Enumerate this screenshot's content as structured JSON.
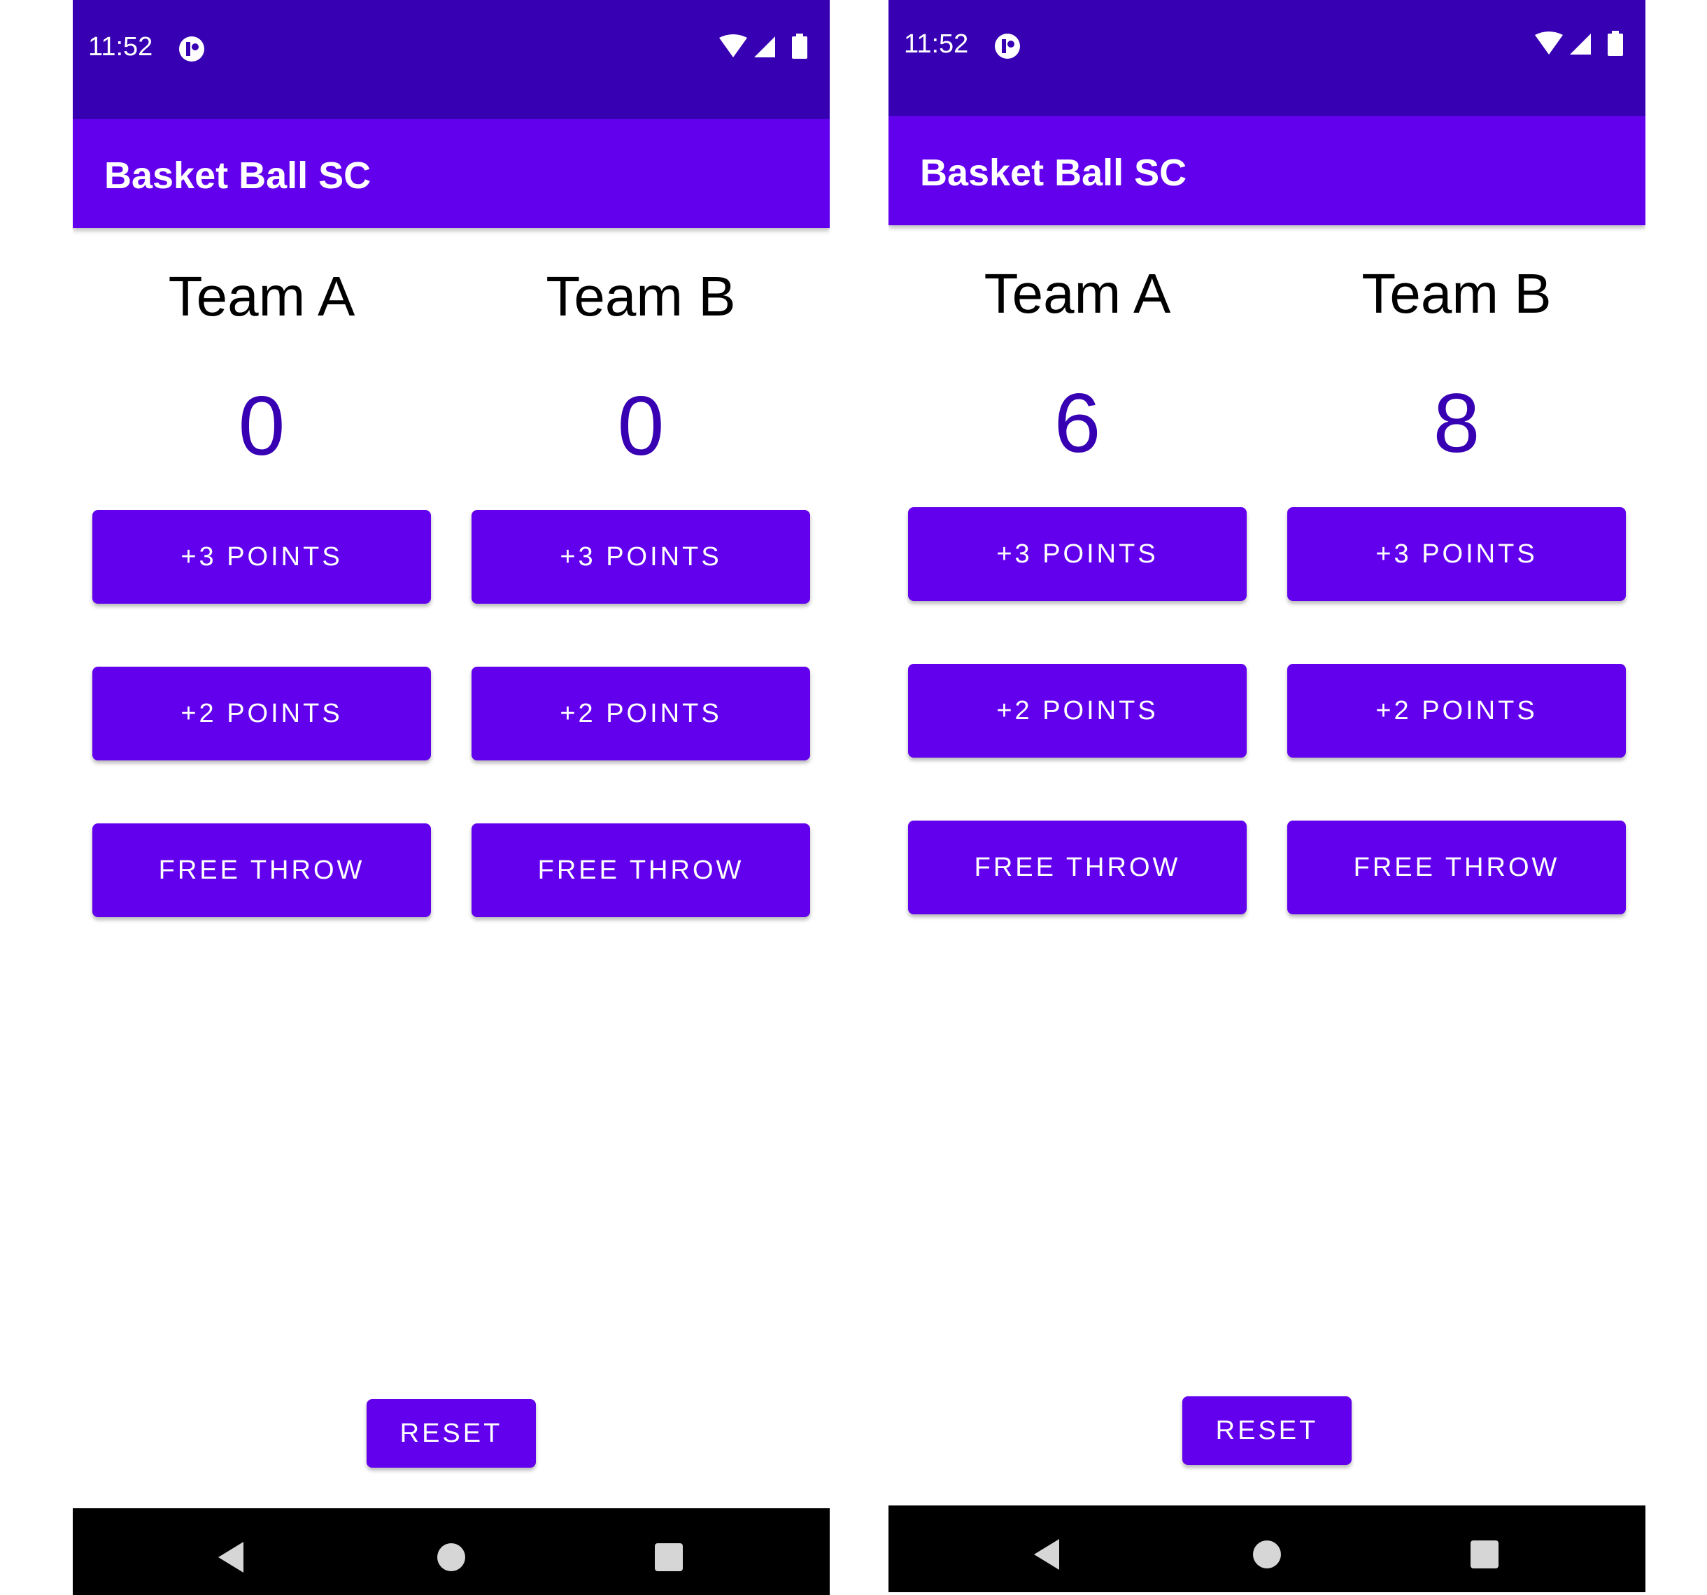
{
  "screens": [
    {
      "status_bar": {
        "time": "11:52"
      },
      "app_bar": {
        "title": "Basket Ball SC"
      },
      "team_a": {
        "label": "Team A",
        "score": "0",
        "buttons": {
          "three": "+3 POINTS",
          "two": "+2 POINTS",
          "free": "FREE THROW"
        }
      },
      "team_b": {
        "label": "Team B",
        "score": "0",
        "buttons": {
          "three": "+3 POINTS",
          "two": "+2 POINTS",
          "free": "FREE THROW"
        }
      },
      "reset_label": "RESET"
    },
    {
      "status_bar": {
        "time": "11:52"
      },
      "app_bar": {
        "title": "Basket Ball SC"
      },
      "team_a": {
        "label": "Team A",
        "score": "6",
        "buttons": {
          "three": "+3 POINTS",
          "two": "+2 POINTS",
          "free": "FREE THROW"
        }
      },
      "team_b": {
        "label": "Team B",
        "score": "8",
        "buttons": {
          "three": "+3 POINTS",
          "two": "+2 POINTS",
          "free": "FREE THROW"
        }
      },
      "reset_label": "RESET"
    }
  ],
  "colors": {
    "status_bar": "#3700b3",
    "primary": "#6200ee",
    "score_text": "#3700b3",
    "nav_bar": "#000000"
  },
  "icons": {
    "status_left": "app-notification-icon",
    "status_right": [
      "wifi-icon",
      "cell-signal-icon",
      "battery-icon"
    ],
    "nav": [
      "back-icon",
      "home-icon",
      "recents-icon"
    ]
  }
}
